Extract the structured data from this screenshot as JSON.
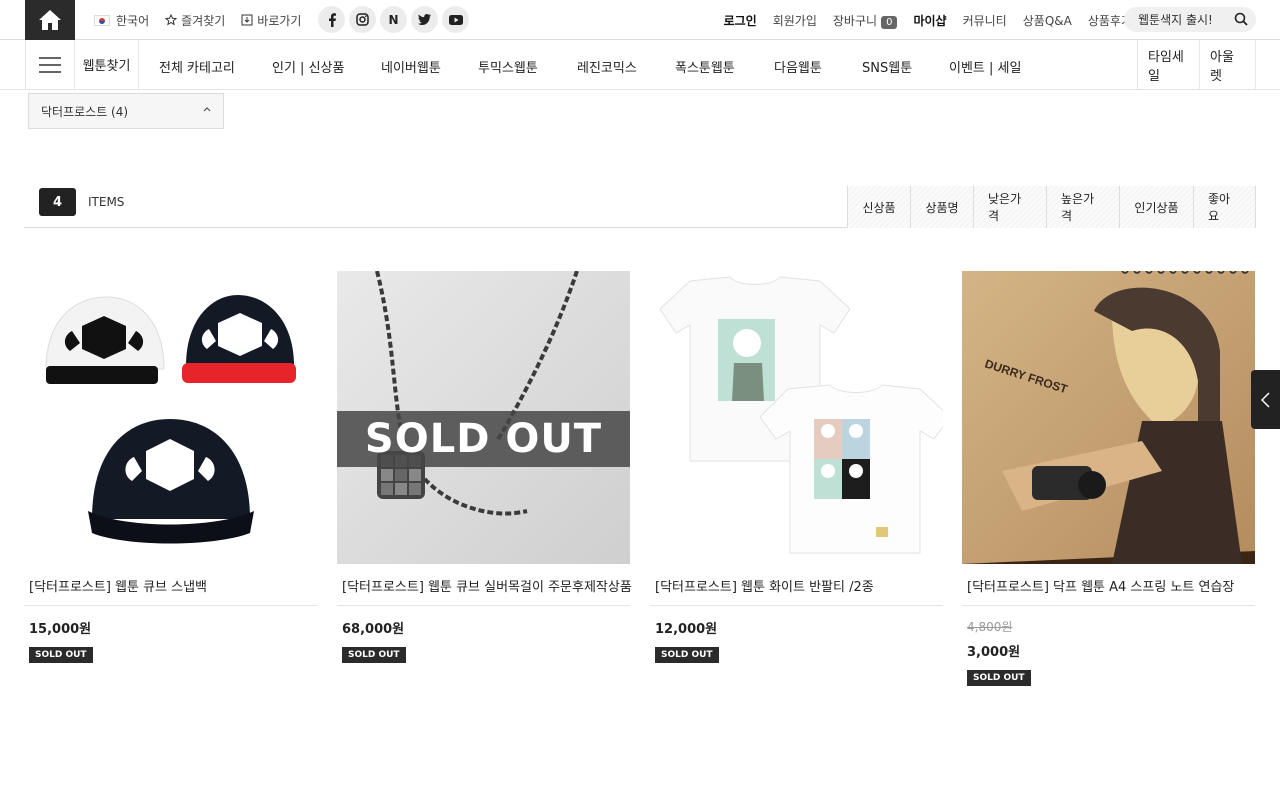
{
  "topbar": {
    "language": "한국어",
    "bookmark": "즐겨찾기",
    "shortcut": "바로가기",
    "social_icons": [
      "facebook-icon",
      "instagram-icon",
      "naver-icon",
      "twitter-icon",
      "youtube-icon"
    ],
    "naver_letter": "N",
    "login": "로그인",
    "join": "회원가입",
    "cart": "장바구니",
    "cart_count": "0",
    "mypage": "마이샵",
    "community": "커뮤니티",
    "qna": "상품Q&A",
    "review": "상품후기",
    "search_value": "웹툰색지 출시!"
  },
  "nav": {
    "first": "웹툰찾기",
    "items": [
      "전체 카테고리",
      "인기 | 신상품",
      "네이버웹툰",
      "투믹스웹툰",
      "레진코믹스",
      "폭스툰웹툰",
      "다음웹툰",
      "SNS웹툰",
      "이벤트 | 세일"
    ],
    "right": [
      "타임세일",
      "아울렛"
    ]
  },
  "filter": {
    "label": "닥터프로스트 (4)"
  },
  "list": {
    "count": "4",
    "items_label": "ITEMS",
    "sort_tabs": [
      "신상품",
      "상품명",
      "낮은가격",
      "높은가격",
      "인기상품",
      "좋아요"
    ]
  },
  "products": [
    {
      "name": "[닥터프로스트] 웹툰 큐브 스냅백",
      "price": "15,000원",
      "badge": "SOLD OUT"
    },
    {
      "name": "[닥터프로스트] 웹툰 큐브 실버목걸이 주문후제작상품",
      "price": "68,000원",
      "badge": "SOLD OUT",
      "overlay": "SOLD OUT"
    },
    {
      "name": "[닥터프로스트] 웹툰 화이트 반팔티 /2종",
      "price": "12,000원",
      "badge": "SOLD OUT"
    },
    {
      "name": "[닥터프로스트] 닥프 웹툰 A4 스프링 노트 연습장",
      "old_price": "4,800원",
      "price": "3,000원",
      "badge": "SOLD OUT",
      "cover_text": "DURRY FROST"
    }
  ],
  "colors": {
    "dark": "#2b2b2b",
    "border": "#dcdcdc",
    "badge_bg": "#2b2b2b"
  }
}
